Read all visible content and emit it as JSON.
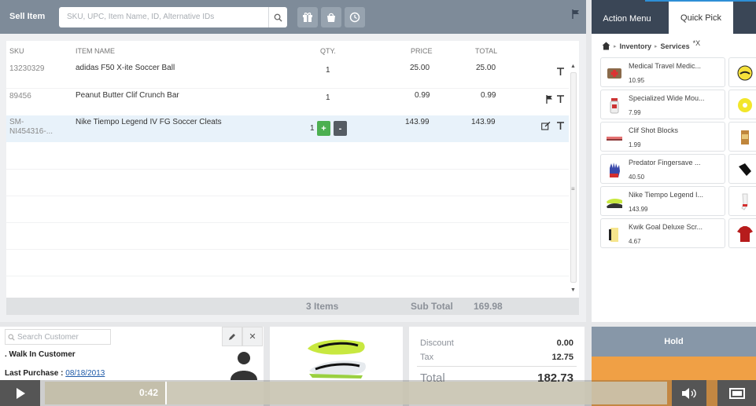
{
  "header": {
    "title": "Sell Item",
    "search_placeholder": "SKU, UPC, Item Name, ID, Alternative IDs"
  },
  "table": {
    "columns": [
      "SKU",
      "ITEM NAME",
      "QTY.",
      "PRICE",
      "TOTAL"
    ],
    "rows": [
      {
        "sku": "13230329",
        "name": "adidas F50 X-ite Soccer Ball",
        "qty": "1",
        "price": "25.00",
        "total": "25.00"
      },
      {
        "sku": "89456",
        "name": "Peanut Butter Clif Crunch Bar",
        "qty": "1",
        "price": "0.99",
        "total": "0.99"
      },
      {
        "sku": "SM-\nNI454316-...",
        "name": "Nike Tiempo Legend IV FG Soccer Cleats",
        "qty": "1",
        "price": "143.99",
        "total": "143.99"
      }
    ],
    "footer": {
      "items": "3 Items",
      "subtotal_label": "Sub Total",
      "subtotal": "169.98"
    }
  },
  "customer": {
    "search_placeholder": "Search Customer",
    "name": ". Walk In Customer",
    "last_purchase_label": "Last Purchase :",
    "last_purchase_date": "08/18/2013"
  },
  "totals": {
    "discount_label": "Discount",
    "discount": "0.00",
    "tax_label": "Tax",
    "tax": "12.75",
    "total_label": "Total",
    "total": "182.73"
  },
  "right_panel": {
    "tabs": [
      "Action Menu",
      "Quick Pick"
    ],
    "crumbs": [
      "Inventory",
      "Services"
    ],
    "crumb_close": "*X",
    "products": [
      {
        "name": "Medical Travel Medic...",
        "price": "10.95",
        "icon": "medical-kit-icon"
      },
      {
        "name": "Specialized Wide Mou...",
        "price": "7.99",
        "icon": "water-bottle-icon"
      },
      {
        "name": "Clif Shot Blocks",
        "price": "1.99",
        "icon": "energy-chews-icon"
      },
      {
        "name": "Predator Fingersave ...",
        "price": "40.50",
        "icon": "goalie-glove-icon"
      },
      {
        "name": "Nike Tiempo Legend I...",
        "price": "143.99",
        "icon": "soccer-cleat-icon"
      },
      {
        "name": "Kwik Goal Deluxe Scr...",
        "price": "4.67",
        "icon": "scrimmage-vest-icon"
      }
    ],
    "hold_label": "Hold"
  },
  "video": {
    "time": "0:42",
    "progress": 0.196
  },
  "colors": {
    "header": "#7e8b99",
    "accent_green": "#4caf50",
    "accent_blue": "#2e8fd6",
    "hold": "#8797a8",
    "orange": "#f0a045"
  }
}
